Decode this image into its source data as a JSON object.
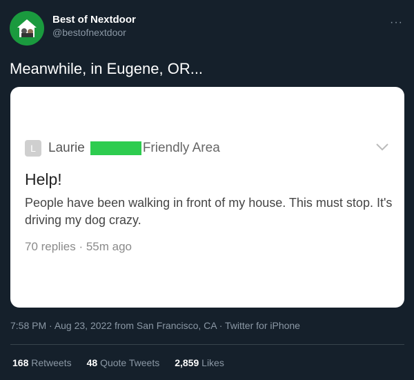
{
  "header": {
    "display_name": "Best of Nextdoor",
    "handle": "@bestofnextdoor",
    "more": "···"
  },
  "tweet": {
    "text": "Meanwhile, in Eugene, OR..."
  },
  "embedded_post": {
    "avatar_letter": "L",
    "author": "Laurie",
    "area": "Friendly Area",
    "title": "Help!",
    "body": "People have been walking in front of my house. This must stop. It's driving my dog crazy.",
    "replies": "70 replies",
    "separator": " · ",
    "age": "55m ago",
    "redaction_color": "#2ecc4f"
  },
  "meta": {
    "time": "7:58 PM",
    "sep1": " · ",
    "date": "Aug 23, 2022",
    "from_text": " from ",
    "location": "San Francisco, CA",
    "sep2": " · ",
    "source": "Twitter for iPhone"
  },
  "stats": {
    "retweets_count": "168",
    "retweets_label": "Retweets",
    "quotes_count": "48",
    "quotes_label": "Quote Tweets",
    "likes_count": "2,859",
    "likes_label": "Likes"
  },
  "colors": {
    "background": "#15202b",
    "secondary_text": "#8b98a5",
    "brand_green": "#1a9a3e"
  }
}
